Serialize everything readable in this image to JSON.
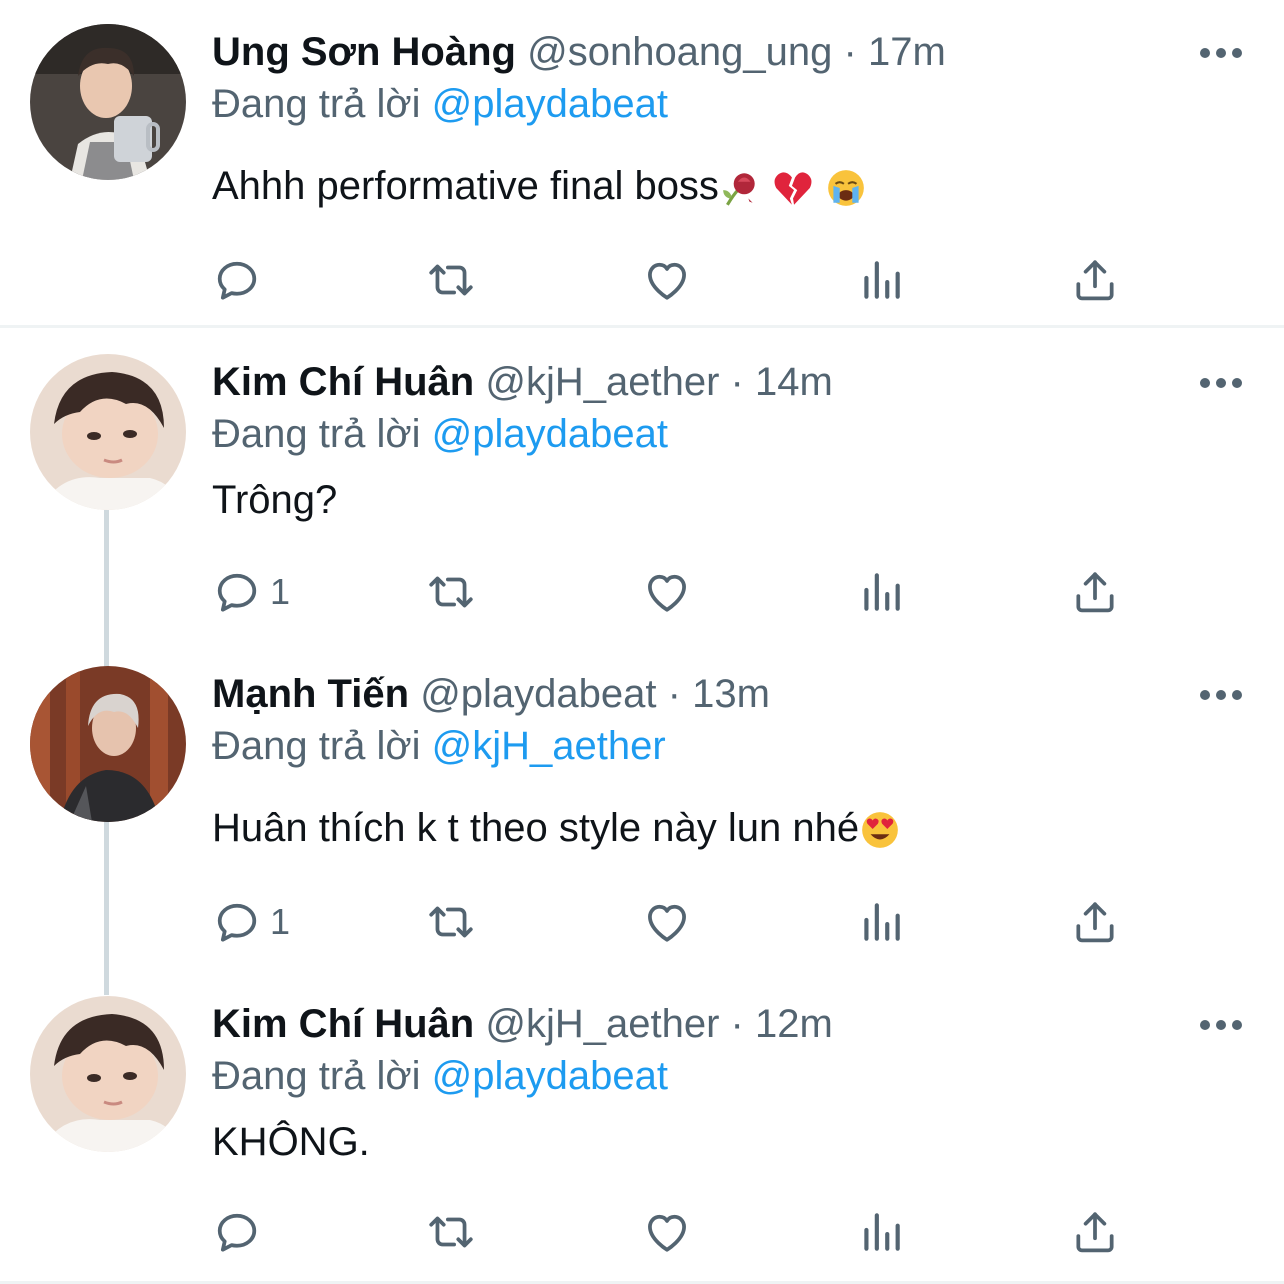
{
  "colors": {
    "accent": "#1d9bf0",
    "secondary_text": "#536471",
    "primary_text": "#0f1419",
    "divider": "#eff3f4",
    "thread_line": "#cfd9de"
  },
  "icons": {
    "reply": "speech-bubble-icon",
    "retweet": "retweet-icon",
    "like": "heart-icon",
    "views": "bar-chart-icon",
    "share": "share-upload-icon",
    "more": "ellipsis-icon"
  },
  "tweets": [
    {
      "name": "Ung Sơn Hoàng",
      "handle": "@sonhoang_ung",
      "dot": "·",
      "time": "17m",
      "reply_prefix": "Đang trả lời",
      "reply_to": "@playdabeat",
      "text": "Ahhh performative final boss",
      "emojis": [
        "wilted-rose",
        "broken-heart",
        "loudly-crying-face"
      ],
      "reply_count": ""
    },
    {
      "name": "Kim Chí Huân",
      "handle": "@kjH_aether",
      "dot": "·",
      "time": "14m",
      "reply_prefix": "Đang trả lời",
      "reply_to": "@playdabeat",
      "text": "Trông?",
      "emojis": [],
      "reply_count": "1"
    },
    {
      "name": "Mạnh Tiến",
      "handle": "@playdabeat",
      "dot": "·",
      "time": "13m",
      "reply_prefix": "Đang trả lời",
      "reply_to": "@kjH_aether",
      "text": "Huân thích k t theo style này lun nhé",
      "emojis": [
        "heart-eyes-face"
      ],
      "reply_count": "1"
    },
    {
      "name": "Kim Chí Huân",
      "handle": "@kjH_aether",
      "dot": "·",
      "time": "12m",
      "reply_prefix": "Đang trả lời",
      "reply_to": "@playdabeat",
      "text": "KHÔNG.",
      "emojis": [],
      "reply_count": ""
    }
  ]
}
